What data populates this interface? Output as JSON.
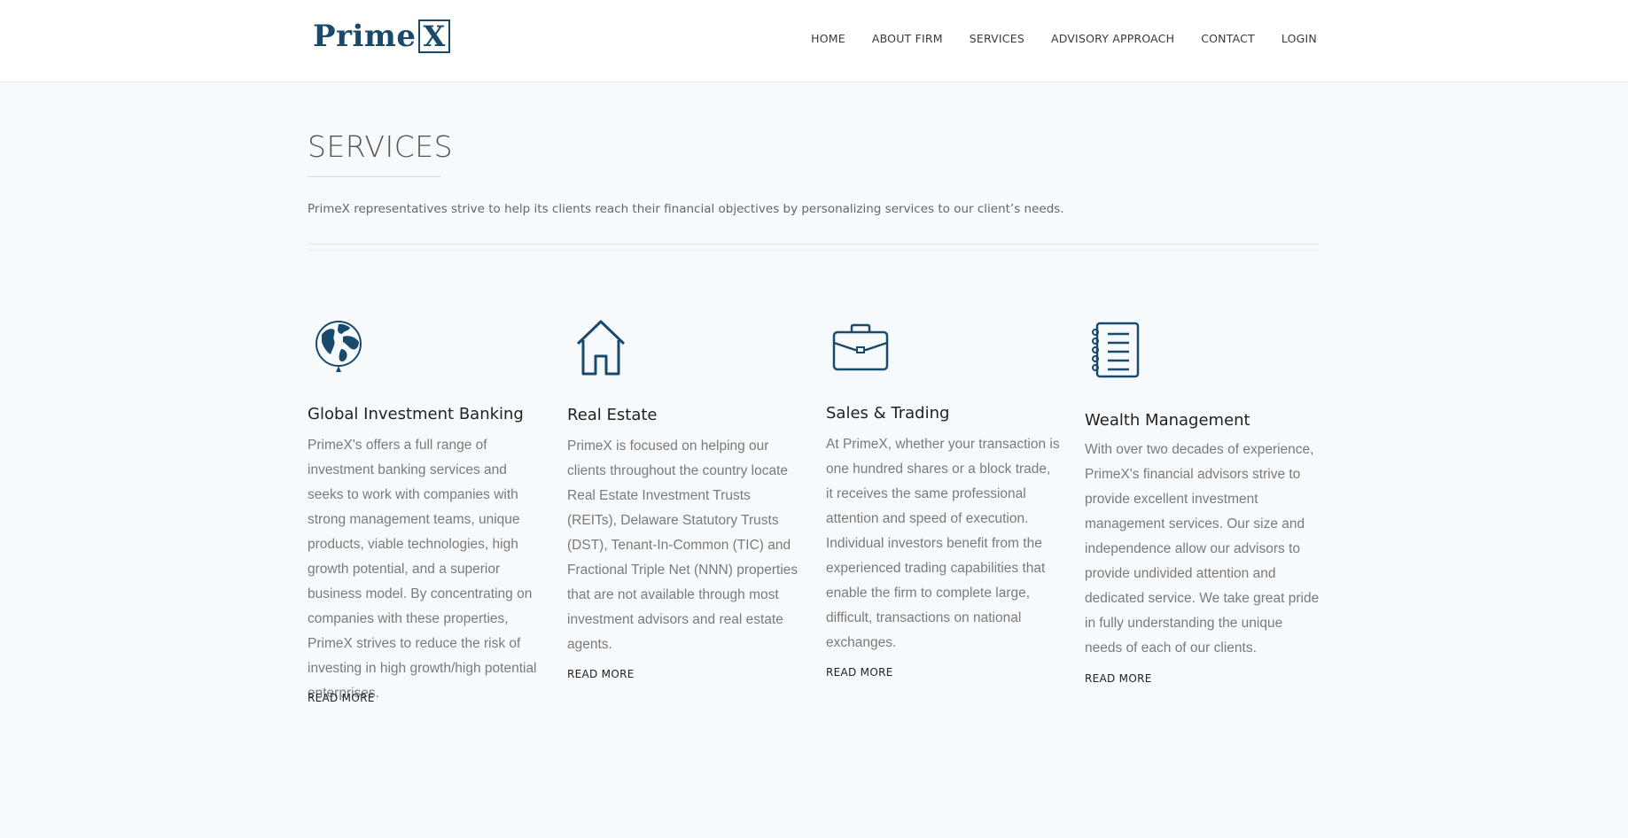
{
  "brand": {
    "name": "Prime",
    "mark": "X",
    "color": "#1a4a6b"
  },
  "nav": [
    "HOME",
    "ABOUT FIRM",
    "SERVICES",
    "ADVISORY APPROACH",
    "CONTACT",
    "LOGIN"
  ],
  "page": {
    "title": "SERVICES",
    "intro": "PrimeX representatives strive to help its clients reach their financial objectives by personalizing services to our client’s needs."
  },
  "services": [
    {
      "icon": "globe-icon",
      "title": "Global Investment Banking",
      "text": "PrimeX's offers a full range of investment banking services and seeks to work with companies with strong management teams, unique products, viable technologies, high growth potential, and a superior business model. By concentrating on companies with these properties, PrimeX strives to reduce the risk of investing in high growth/high potential enterprises.",
      "more": "READ MORE"
    },
    {
      "icon": "house-icon",
      "title": "Real Estate",
      "text": "PrimeX is focused on helping our clients throughout the country locate Real Estate Investment Trusts (REITs), Delaware Statutory Trusts (DST), Tenant-In-Common (TIC) and Fractional Triple Net (NNN) properties that are not available through most investment advisors and real estate agents.",
      "more": "READ MORE"
    },
    {
      "icon": "briefcase-icon",
      "title": "Sales & Trading",
      "text": "At PrimeX, whether your transaction is one hundred shares or a block trade, it receives the same professional attention and speed of execution. Individual investors benefit from the experienced trading capabilities that enable the firm to complete large, difficult, transactions on national exchanges.",
      "more": "READ MORE"
    },
    {
      "icon": "notebook-icon",
      "title": "Wealth Management",
      "text": "With over two decades of experience, PrimeX's financial advisors strive to provide excellent investment management services. Our size and independence allow our advisors to provide undivided attention and dedicated service. We take great pride in fully understanding the unique needs of each of our clients.",
      "more": "READ MORE"
    }
  ]
}
